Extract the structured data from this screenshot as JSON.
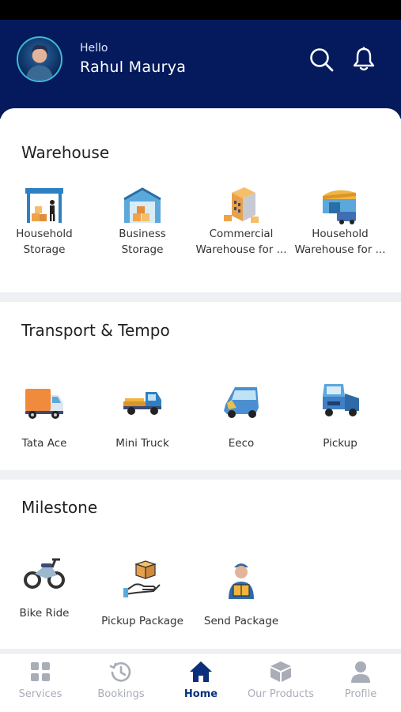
{
  "header": {
    "greeting": "Hello",
    "user_name": "Rahul Maurya"
  },
  "sections": {
    "warehouse": {
      "title": "Warehouse",
      "items": [
        {
          "line1": "Household",
          "line2": "Storage",
          "icon": "household-storage-icon"
        },
        {
          "line1": "Business",
          "line2": "Storage",
          "icon": "business-storage-icon"
        },
        {
          "line1": "Commercial",
          "line2": "Warehouse for ...",
          "icon": "commercial-warehouse-icon"
        },
        {
          "line1": "Household",
          "line2": "Warehouse for ...",
          "icon": "household-warehouse-icon"
        }
      ]
    },
    "transport": {
      "title": "Transport & Tempo",
      "items": [
        {
          "label": "Tata Ace",
          "icon": "tata-ace-truck-icon"
        },
        {
          "label": "Mini Truck",
          "icon": "mini-truck-icon"
        },
        {
          "label": "Eeco",
          "icon": "eeco-van-icon"
        },
        {
          "label": "Pickup",
          "icon": "pickup-truck-icon"
        }
      ]
    },
    "milestone": {
      "title": "Milestone",
      "items": [
        {
          "label": "Bike Ride",
          "icon": "motorbike-icon"
        },
        {
          "label": "Pickup Package",
          "icon": "pickup-package-icon"
        },
        {
          "label": "Send Package",
          "icon": "send-package-icon"
        }
      ]
    }
  },
  "nav": {
    "items": [
      {
        "label": "Services",
        "icon": "grid-icon"
      },
      {
        "label": "Bookings",
        "icon": "history-icon"
      },
      {
        "label": "Home",
        "icon": "home-icon",
        "active": true
      },
      {
        "label": "Our Products",
        "icon": "box-icon"
      },
      {
        "label": "Profile",
        "icon": "user-icon"
      }
    ]
  },
  "colors": {
    "header_bg": "#041a5c",
    "accent": "#0b2f7a",
    "inactive": "#a9adb7"
  }
}
